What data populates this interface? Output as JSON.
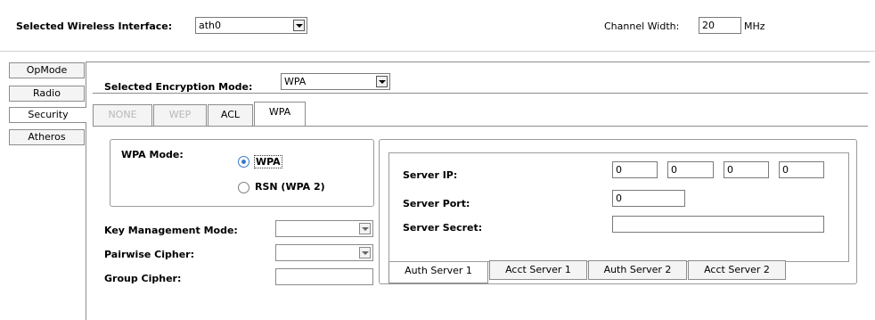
{
  "header": {
    "interface_label": "Selected Wireless Interface:",
    "interface_value": "ath0",
    "channel_width_label": "Channel Width:",
    "channel_width_value": "20",
    "channel_width_unit": "MHz"
  },
  "side_tabs": [
    {
      "label": "OpMode"
    },
    {
      "label": "Radio"
    },
    {
      "label": "Security"
    },
    {
      "label": "Atheros"
    }
  ],
  "encryption": {
    "label": "Selected Encryption Mode:",
    "value": "WPA"
  },
  "enc_tabs": [
    {
      "label": "NONE"
    },
    {
      "label": "WEP"
    },
    {
      "label": "ACL"
    },
    {
      "label": "WPA"
    }
  ],
  "wpa": {
    "mode_label": "WPA Mode:",
    "options": [
      {
        "label": "WPA",
        "checked": true
      },
      {
        "label": "RSN (WPA 2)",
        "checked": false
      }
    ],
    "key_mgmt_label": "Key Management Mode:",
    "key_mgmt_value": "",
    "pairwise_label": "Pairwise Cipher:",
    "pairwise_value": "",
    "group_label": "Group Cipher:",
    "group_value": ""
  },
  "server": {
    "ip_label": "Server IP:",
    "ip_octets": [
      "0",
      "0",
      "0",
      "0"
    ],
    "port_label": "Server Port:",
    "port_value": "0",
    "secret_label": "Server Secret:",
    "secret_value": "",
    "tabs": [
      {
        "label": "Auth Server 1"
      },
      {
        "label": "Acct Server 1"
      },
      {
        "label": "Auth Server 2"
      },
      {
        "label": "Acct Server 2"
      }
    ]
  },
  "colors": {
    "radio_accent": "#3a78c8",
    "border": "#8c8c8c",
    "disabled_text": "#b8b8b8"
  }
}
